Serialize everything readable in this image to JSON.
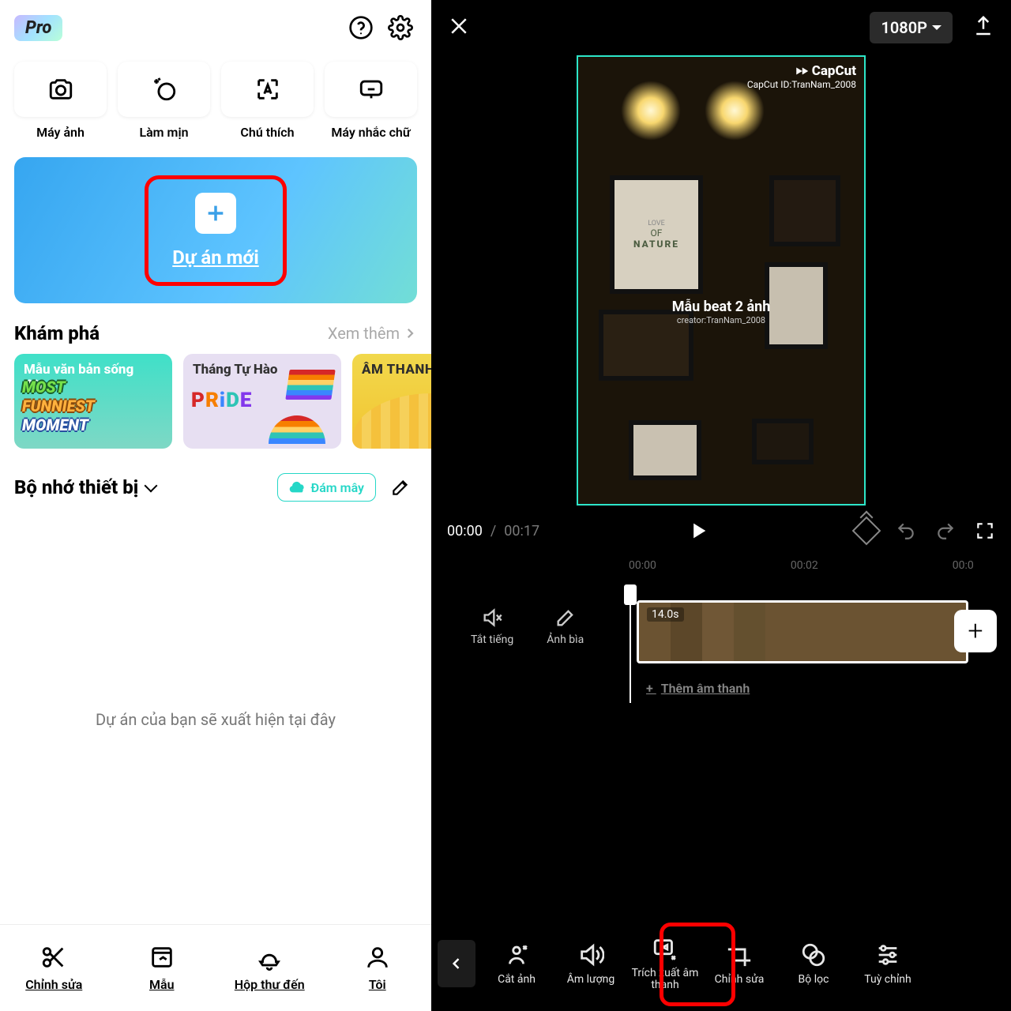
{
  "left": {
    "pro_badge": "Pro",
    "tools": [
      {
        "label": "Máy ảnh"
      },
      {
        "label": "Làm mịn"
      },
      {
        "label": "Chú thích"
      },
      {
        "label": "Máy nhắc chữ"
      }
    ],
    "new_project_label": "Dự án mới",
    "explore": {
      "title": "Khám phá",
      "more": "Xem thêm"
    },
    "cards": [
      {
        "title": "Mẫu văn bản sống động",
        "line1": "MOST",
        "line2": "FUNNIEST",
        "line3": "MOMENT"
      },
      {
        "title": "Tháng Tự Hào",
        "pride": "PRIDE"
      },
      {
        "title": "ÂM THANH"
      }
    ],
    "storage": {
      "title": "Bộ nhớ thiết bị",
      "cloud": "Đám mây"
    },
    "empty_text": "Dự án của bạn sẽ xuất hiện tại đây",
    "nav": [
      {
        "label": "Chỉnh sửa"
      },
      {
        "label": "Mẫu"
      },
      {
        "label": "Hộp thư đến"
      },
      {
        "label": "Tôi"
      }
    ]
  },
  "right": {
    "resolution": "1080P",
    "watermark": {
      "brand": "CapCut",
      "id_label": "CapCut ID:TranNam_2008"
    },
    "caption": {
      "main": "Mẫu beat 2 ảnh",
      "sub": "creator:TranNam_2008"
    },
    "frame_nature_small": "OF",
    "frame_nature_big": "NATURE",
    "time": {
      "current": "00:00",
      "sep": "/",
      "total": "00:17"
    },
    "ruler": [
      "00:00",
      "00:02",
      "00:0"
    ],
    "timeline": {
      "mute": "Tắt tiếng",
      "cover": "Ảnh bìa",
      "clip_duration": "14.0s",
      "add_audio": "Thêm âm thanh"
    },
    "nav": [
      {
        "label": "Cắt ảnh"
      },
      {
        "label": "Âm lượng"
      },
      {
        "label": "Trích xuất âm thanh"
      },
      {
        "label": "Chỉnh sửa"
      },
      {
        "label": "Bộ lọc"
      },
      {
        "label": "Tuỳ chỉnh"
      }
    ]
  }
}
